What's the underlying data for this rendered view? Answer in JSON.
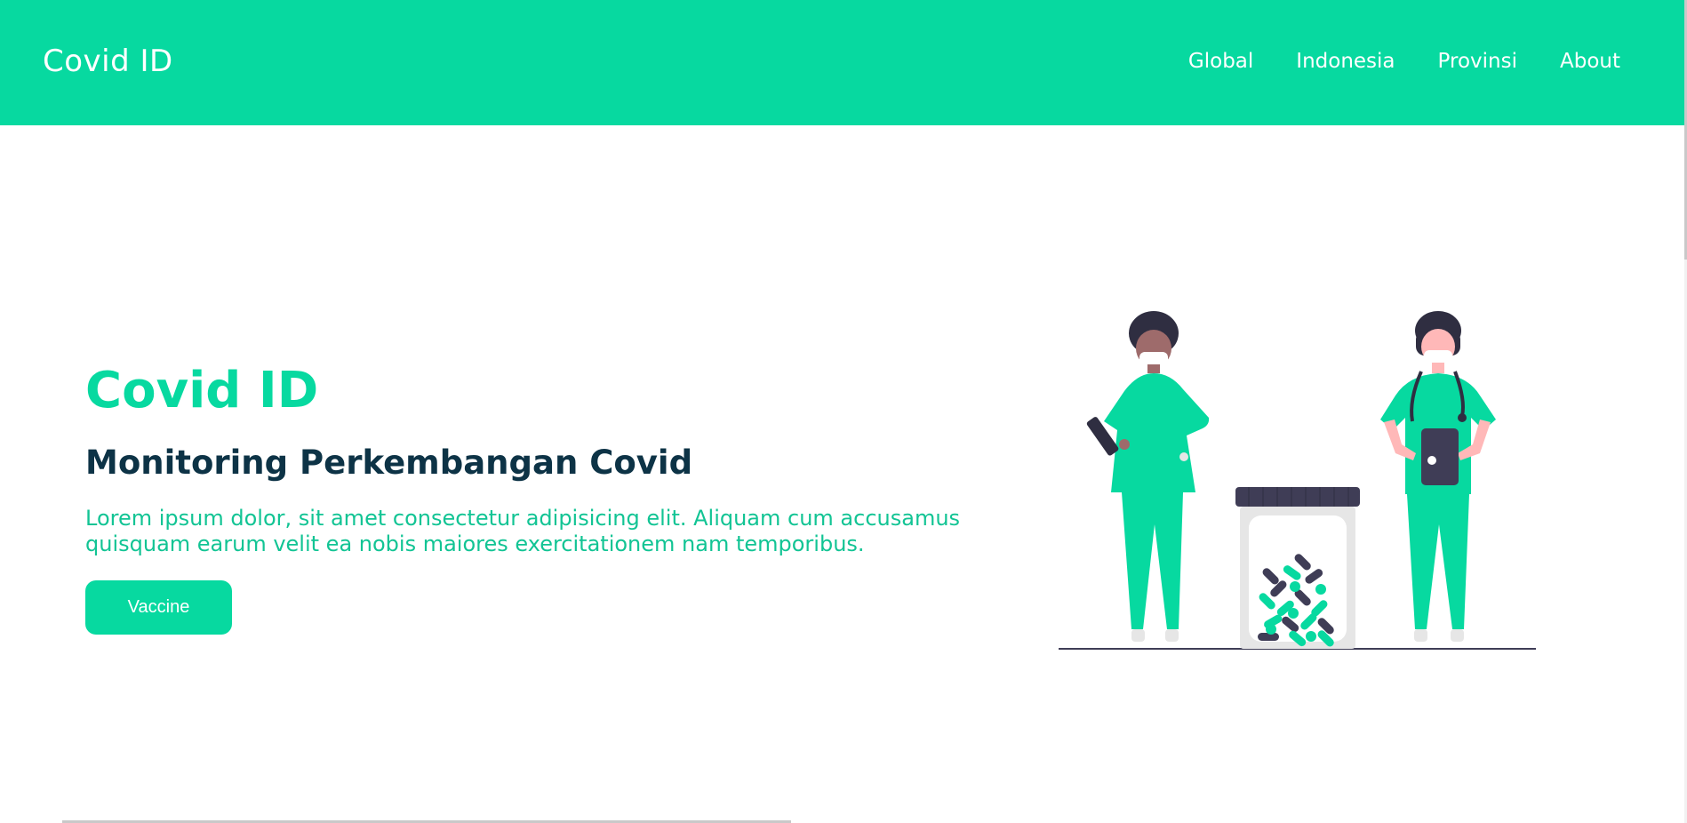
{
  "navbar": {
    "brand": "Covid ID",
    "links": [
      "Global",
      "Indonesia",
      "Provinsi",
      "About"
    ]
  },
  "hero": {
    "title": "Covid ID",
    "subtitle": "Monitoring Perkembangan Covid",
    "text": "Lorem ipsum dolor, sit amet consectetur adipisicing elit. Aliquam cum accusamus quisquam earum velit ea nobis maiores exercitationem nam temporibus.",
    "button_label": "Vaccine"
  },
  "illustration": {
    "icon": "doctors-with-pill-jar-illustration"
  },
  "colors": {
    "accent": "#07d9a0",
    "heading": "#0d3346",
    "text": "#12c494",
    "dark": "#3f3d56"
  }
}
